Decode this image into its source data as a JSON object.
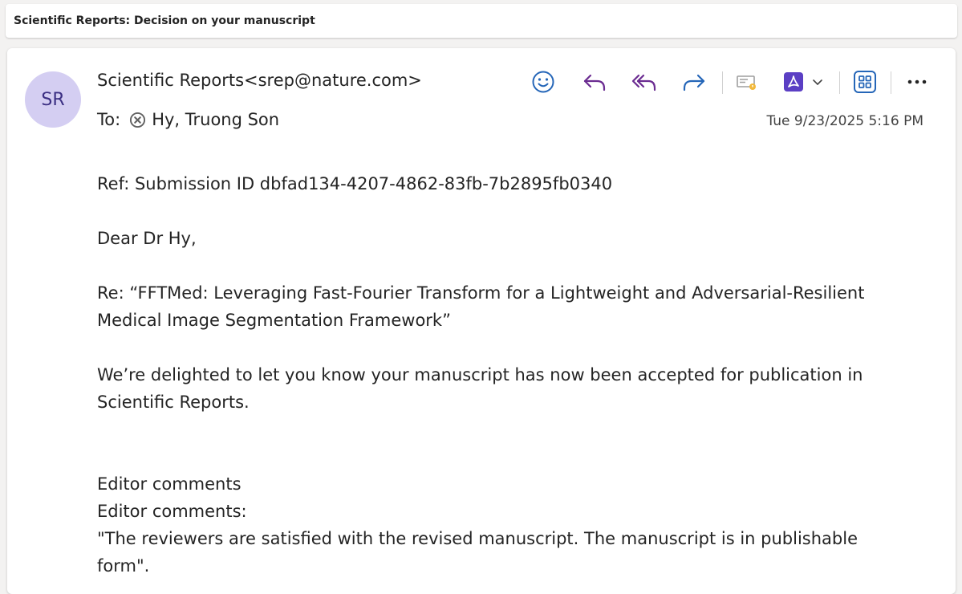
{
  "subject": "Scientific Reports: Decision on your manuscript",
  "avatar": {
    "initials": "SR",
    "color": "#d4cef2"
  },
  "sender": "Scientific Reports<srep@nature.com>",
  "recipient": {
    "label": "To:",
    "name": "Hy, Truong Son"
  },
  "timestamp": "Tue 9/23/2025 5:16 PM",
  "toolbar": {
    "icons": [
      "emoji-icon",
      "reply-icon",
      "reply-all-icon",
      "forward-icon",
      "message-flag-icon",
      "pdf-icon",
      "chevron-down-icon",
      "apps-icon",
      "more-icon"
    ]
  },
  "body": {
    "ref": "Ref: Submission ID dbfad134-4207-4862-83fb-7b2895fb0340",
    "greeting": "Dear Dr Hy,",
    "re_line1": "Re: “FFTMed: Leveraging Fast-Fourier Transform for a Lightweight and Adversarial-Resilient",
    "re_line2": "Medical Image Segmentation Framework”",
    "accept_line1": "We’re delighted to let you know your manuscript has now been accepted for publication in",
    "accept_line2": "Scientific Reports.",
    "editor1": "Editor comments",
    "editor2": "Editor comments:",
    "quote_line1": "\"The reviewers are satisfied with the revised manuscript. The manuscript is in publishable",
    "quote_line2": "form\"."
  },
  "colors": {
    "accent_purple": "#6b2c91",
    "accent_blue": "#2566b8",
    "pdf_purple": "#5b3fc4"
  }
}
